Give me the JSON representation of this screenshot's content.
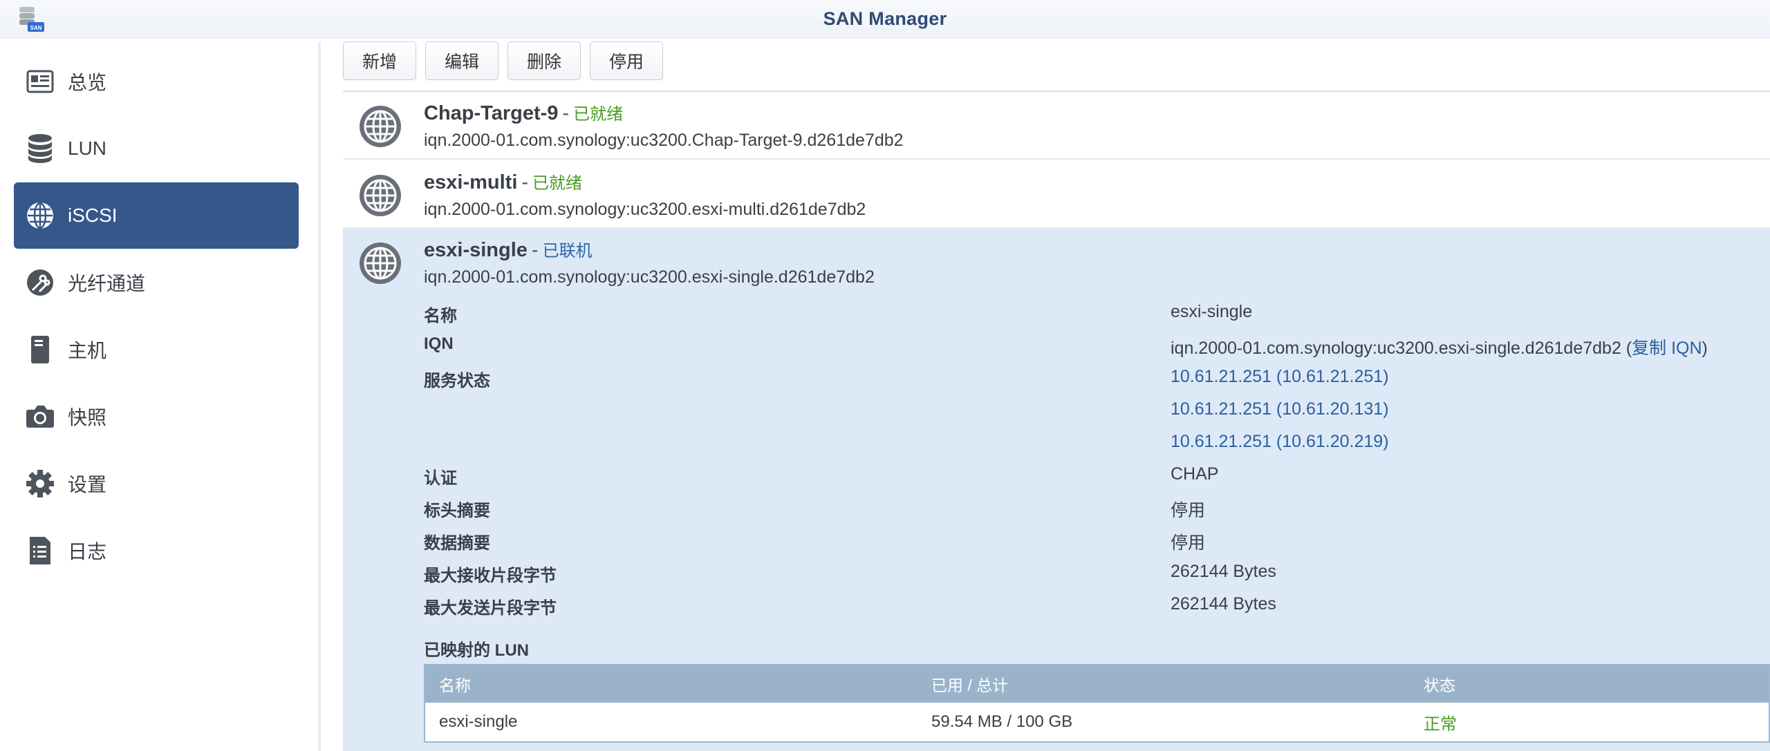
{
  "window": {
    "title": "SAN Manager",
    "app_icon_text": "SAN"
  },
  "sidebar": {
    "active": "iSCSI",
    "items": [
      {
        "label": "总览",
        "icon": "overview-card-icon"
      },
      {
        "label": "LUN",
        "icon": "database-stack-icon"
      },
      {
        "label": "iSCSI",
        "icon": "globe-icon"
      },
      {
        "label": "光纤通道",
        "icon": "fibre-channel-icon"
      },
      {
        "label": "主机",
        "icon": "server-tower-icon"
      },
      {
        "label": "快照",
        "icon": "camera-icon"
      },
      {
        "label": "设置",
        "icon": "gear-icon"
      },
      {
        "label": "日志",
        "icon": "log-list-icon"
      }
    ]
  },
  "toolbar": {
    "add": "新增",
    "edit": "编辑",
    "delete": "删除",
    "disable": "停用"
  },
  "targets": [
    {
      "name": "Chap-Target-9",
      "sep": "-",
      "status": "已就绪",
      "iqn": "iqn.2000-01.com.synology:uc3200.Chap-Target-9.d261de7db2"
    },
    {
      "name": "esxi-multi",
      "sep": "-",
      "status": "已就绪",
      "iqn": "iqn.2000-01.com.synology:uc3200.esxi-multi.d261de7db2"
    },
    {
      "name": "esxi-single",
      "sep": "-",
      "status": "已联机",
      "iqn": "iqn.2000-01.com.synology:uc3200.esxi-single.d261de7db2"
    }
  ],
  "details": {
    "name_label": "名称",
    "name_value": "esxi-single",
    "iqn_label": "IQN",
    "iqn_value": "iqn.2000-01.com.synology:uc3200.esxi-single.d261de7db2",
    "copy_iqn_open": "(",
    "copy_iqn": "复制 IQN",
    "copy_iqn_close": ")",
    "service_label": "服务状态",
    "service_values": [
      "10.61.21.251 (10.61.21.251)",
      "10.61.21.251 (10.61.20.131)",
      "10.61.21.251 (10.61.20.219)"
    ],
    "auth_label": "认证",
    "auth_value": "CHAP",
    "header_digest_label": "标头摘要",
    "header_digest_value": "停用",
    "data_digest_label": "数据摘要",
    "data_digest_value": "停用",
    "max_recv_label": "最大接收片段字节",
    "max_recv_value": "262144 Bytes",
    "max_send_label": "最大发送片段字节",
    "max_send_value": "262144 Bytes"
  },
  "mapped_lun": {
    "title": "已映射的 LUN",
    "headers": {
      "name": "名称",
      "usage": "已用 / 总计",
      "status": "状态"
    },
    "rows": [
      {
        "name": "esxi-single",
        "usage": "59.54 MB / 100 GB",
        "status": "正常"
      }
    ]
  },
  "colors": {
    "accent": "#355789",
    "ready": "#4a9b22",
    "linked": "#2b67a8",
    "expanded_bg": "#dde9f7",
    "table_header": "#9ab3cb"
  }
}
